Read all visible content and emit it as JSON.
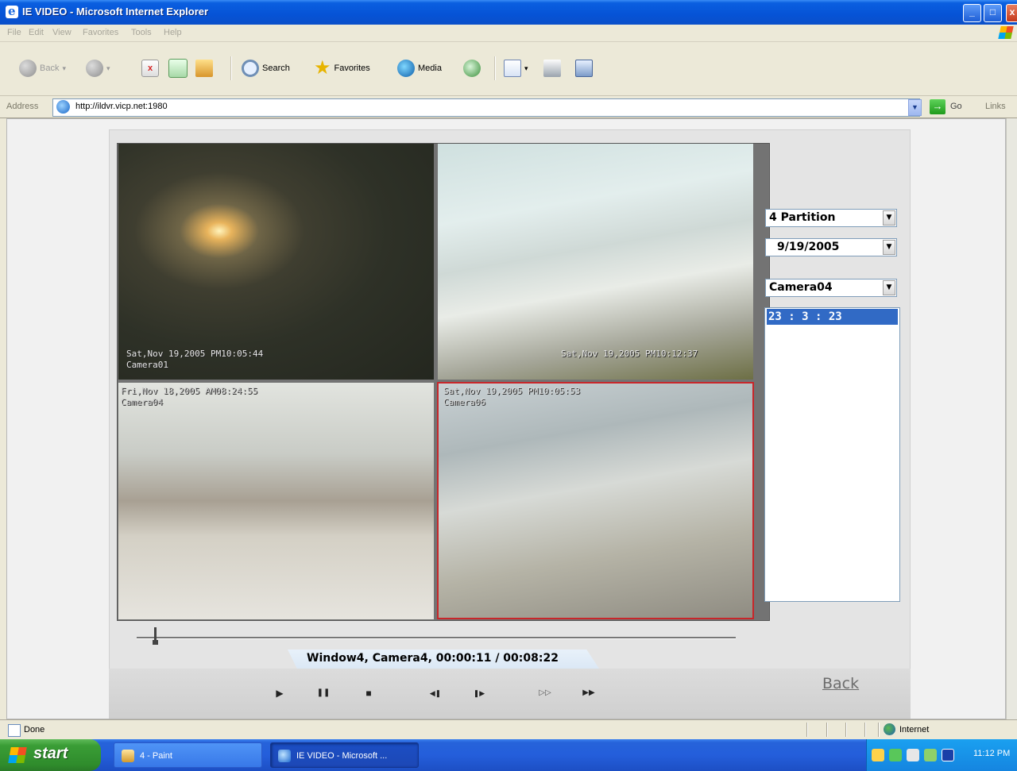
{
  "window": {
    "title": "IE VIDEO - Microsoft Internet Explorer",
    "min": "_",
    "max": "□",
    "close": "x"
  },
  "menu": [
    "File",
    "Edit",
    "View",
    "Favorites",
    "Tools",
    "Help"
  ],
  "toolbar": {
    "back": "Back",
    "search": "Search",
    "favorites": "Favorites",
    "media": "Media"
  },
  "address": {
    "label": "Address",
    "url": "http://ildvr.vicp.net:1980",
    "go": "Go",
    "links": "Links"
  },
  "dvr": {
    "cameras": [
      {
        "timestamp": "Sat,Nov 19,2005 PM10:05:44",
        "name": "Camera01"
      },
      {
        "timestamp": "Sat,Nov 19,2005 PM10:12:37",
        "name": ""
      },
      {
        "timestamp": "Fri,Nov 18,2005 AM08:24:55",
        "name": "Camera04"
      },
      {
        "timestamp": "Sat,Nov 19,2005 PM10:05:53",
        "name": "Camera06"
      }
    ],
    "partition_select": "4 Partition",
    "date_select": "9/19/2005",
    "camera_select": "Camera04",
    "time_list": [
      "23 : 3 : 23"
    ],
    "playback_status": "Window4,  Camera4,  00:00:11 / 00:08:22",
    "controls": {
      "play": "▶",
      "pause": "❚❚",
      "stop": "■",
      "step_back": "◀❚",
      "step_forward": "❚▶",
      "slow": "▷▷",
      "fast": "▶▶"
    },
    "back_link": "Back",
    "playback_position": 0.03
  },
  "statusbar": {
    "status": "Done",
    "zone": "Internet"
  },
  "taskbar": {
    "start": "start",
    "tasks": [
      "4 - Paint",
      "IE VIDEO - Microsoft ..."
    ],
    "clock": "11:12 PM"
  },
  "colors": {
    "xp_blue": "#0653d6",
    "selection": "#316ac5",
    "active_camera_border": "#c8262a"
  }
}
